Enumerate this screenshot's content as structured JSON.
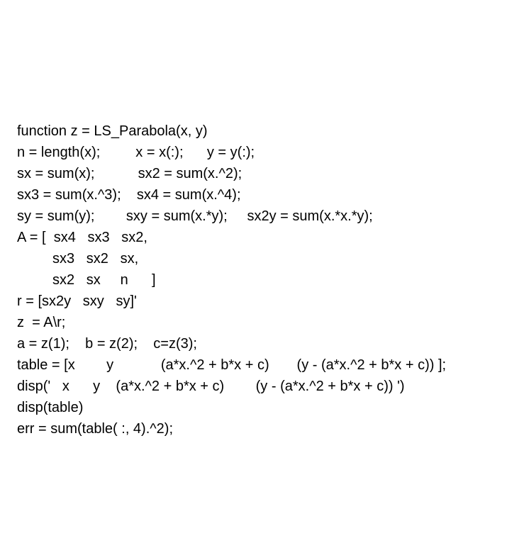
{
  "code": {
    "line1": "function z = LS_Parabola(x, y)",
    "line2": "n = length(x);         x = x(:);      y = y(:);",
    "line3": "sx = sum(x);           sx2 = sum(x.^2);",
    "line4": "sx3 = sum(x.^3);    sx4 = sum(x.^4);",
    "line5": "sy = sum(y);        sxy = sum(x.*y);     sx2y = sum(x.*x.*y);",
    "line6": "A = [  sx4   sx3   sx2,",
    "line7": "         sx3   sx2   sx,",
    "line8": "         sx2   sx     n      ]",
    "line9": "r = [sx2y   sxy   sy]'",
    "line10": "z  = A\\r;",
    "line11": "a = z(1);    b = z(2);    c=z(3);",
    "line12": "table = [x        y            (a*x.^2 + b*x + c)       (y - (a*x.^2 + b*x + c)) ];",
    "line13": "disp('   x      y    (a*x.^2 + b*x + c)        (y - (a*x.^2 + b*x + c)) ')",
    "line14": "disp(table)",
    "line15": "err = sum(table( :, 4).^2);"
  }
}
